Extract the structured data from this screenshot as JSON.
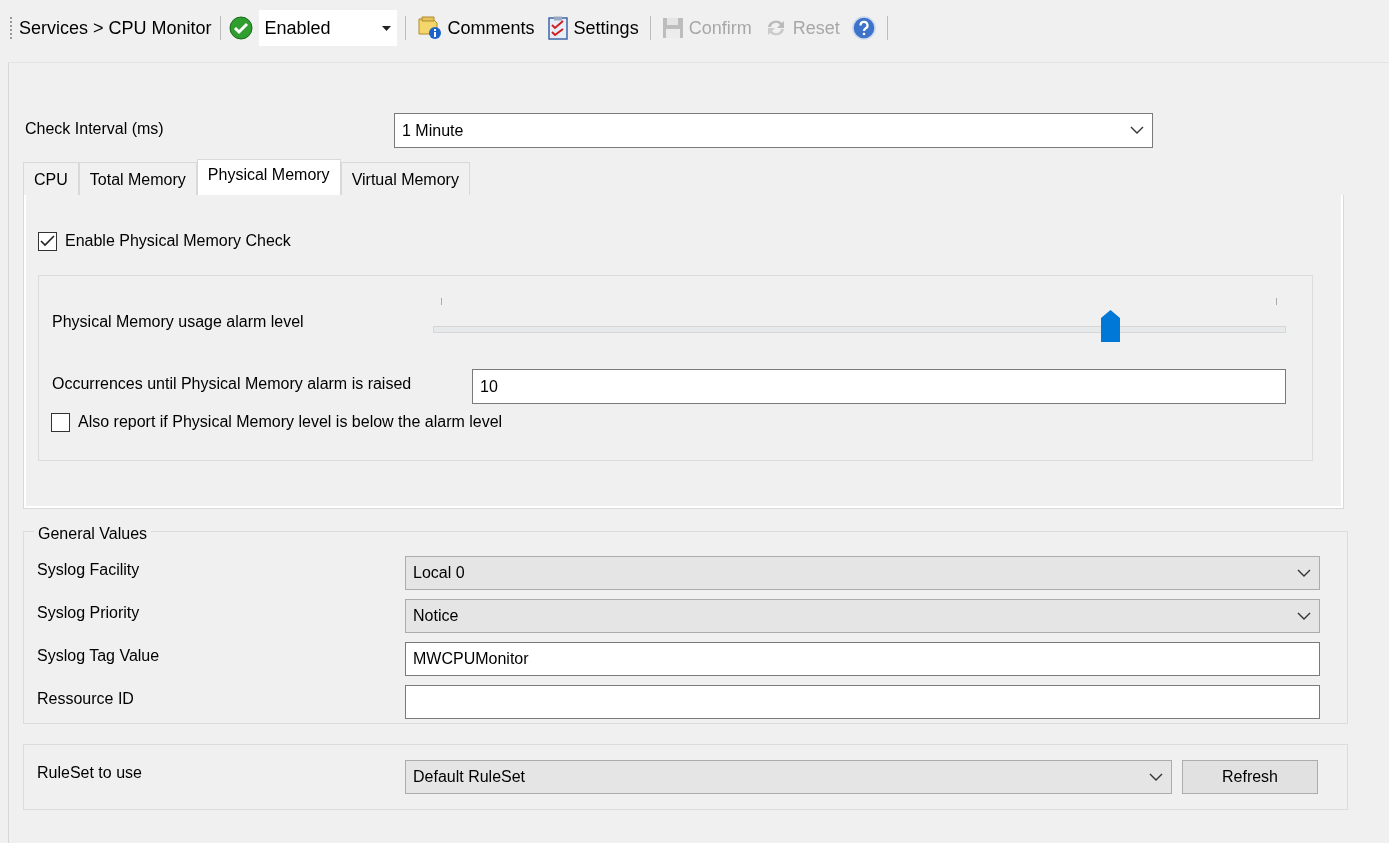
{
  "toolbar": {
    "breadcrumb": "Services > CPU Monitor",
    "status": {
      "value": "Enabled",
      "on": true
    },
    "buttons": [
      {
        "kind": "comments",
        "label": "Comments",
        "disabled": false
      },
      {
        "kind": "settings",
        "label": "Settings",
        "disabled": false
      },
      {
        "kind": "confirm",
        "label": "Confirm",
        "disabled": true
      },
      {
        "kind": "reset",
        "label": "Reset",
        "disabled": true
      },
      {
        "kind": "help",
        "disabled": false
      }
    ]
  },
  "check_interval": {
    "label": "Check Interval (ms)",
    "value": "1 Minute"
  },
  "tabs": [
    {
      "label": "CPU",
      "selected": false
    },
    {
      "label": "Total Memory",
      "selected": false
    },
    {
      "label": "Physical Memory",
      "selected": true
    },
    {
      "label": "Virtual Memory",
      "selected": false
    }
  ],
  "physical": {
    "enable": {
      "label": "Enable Physical Memory Check",
      "checked": true
    },
    "alarm": {
      "label": "Physical Memory usage alarm level",
      "level": 0.8
    },
    "occurrences": {
      "label": "Occurrences until Physical Memory alarm is raised",
      "value": "10"
    },
    "report_below": {
      "label": "Also report if Physical Memory level is below the alarm level",
      "checked": false
    }
  },
  "general": {
    "title": "General Values",
    "fields": [
      {
        "kind": "select",
        "label": "Syslog Facility",
        "value": "Local 0"
      },
      {
        "kind": "select",
        "label": "Syslog Priority",
        "value": "Notice"
      },
      {
        "kind": "text",
        "label": "Syslog Tag Value",
        "value": "MWCPUMonitor"
      },
      {
        "kind": "text",
        "label": "Ressource ID"
      }
    ]
  },
  "ruleset": {
    "label": "RuleSet to use",
    "value": "Default RuleSet",
    "button": "Refresh"
  }
}
